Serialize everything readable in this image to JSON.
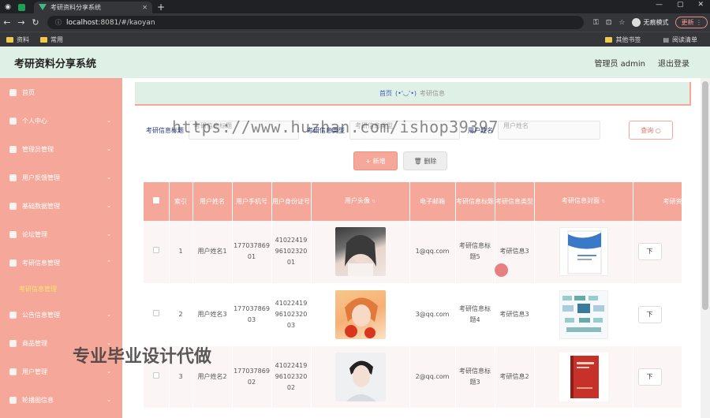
{
  "browser": {
    "tab_inactive_label": "",
    "tab_active_label": "考研资料分享系统",
    "url_host": "localhost",
    "url_rest": ":8081/#/kaoyan",
    "profile_label": "无痕模式",
    "update_label": "更新",
    "bookmarks": [
      "资料",
      "常用"
    ],
    "bookmarks_right": [
      "其他书签",
      "阅读清单"
    ]
  },
  "app": {
    "title": "考研资料分享系统",
    "user_label": "管理员 admin",
    "logout_label": "退出登录"
  },
  "sidebar": {
    "items": [
      {
        "label": "首页",
        "chevron": false
      },
      {
        "label": "个人中心",
        "chevron": true
      },
      {
        "label": "管理员管理",
        "chevron": true
      },
      {
        "label": "用户反馈管理",
        "chevron": true
      },
      {
        "label": "基础数据管理",
        "chevron": true
      },
      {
        "label": "论坛管理",
        "chevron": true
      },
      {
        "label": "考研信息管理",
        "chevron": true,
        "expanded": true
      }
    ],
    "sub_item": "考研信息管理",
    "items_after": [
      {
        "label": "公告信息管理",
        "chevron": true
      },
      {
        "label": "商品管理",
        "chevron": true
      },
      {
        "label": "用户管理",
        "chevron": true
      },
      {
        "label": "轮播图信息",
        "chevron": true
      }
    ]
  },
  "breadcrumb": {
    "home": "首页",
    "face": "(•'◡'•)",
    "current": "考研信息"
  },
  "search": {
    "label1": "考研信息标题",
    "placeholder1": "考研信息标题",
    "label2": "考研信息类型",
    "placeholder2": "考研信息类型",
    "label3": "用户姓名",
    "placeholder3": "用户姓名",
    "button": "查询 ○"
  },
  "actions": {
    "add": "+ 新增",
    "delete": "删除"
  },
  "table": {
    "headers": [
      "索引",
      "用户姓名",
      "用户手机号",
      "用户身份证号",
      "用户头像",
      "电子邮箱",
      "考研信息标题",
      "考研信息类型",
      "考研信息封面",
      "考研资"
    ],
    "rows": [
      {
        "index": "1",
        "name": "用户姓名1",
        "phone": "17703786901",
        "idcard": "410224199610232001",
        "email": "1@qq.com",
        "title": "考研信息标题5",
        "type": "考研信息3",
        "op": "下"
      },
      {
        "index": "2",
        "name": "用户姓名3",
        "phone": "17703786903",
        "idcard": "410224199610232003",
        "email": "3@qq.com",
        "title": "考研信息标题4",
        "type": "考研信息3",
        "op": "下"
      },
      {
        "index": "3",
        "name": "用户姓名2",
        "phone": "17703786902",
        "idcard": "410224199610232002",
        "email": "2@qq.com",
        "title": "考研信息标题3",
        "type": "考研信息2",
        "op": "下"
      }
    ]
  },
  "watermarks": {
    "url": "https://www.huzhan.com/ishop39397",
    "cn": "专业毕业设计代做"
  },
  "colors": {
    "accent": "#f5a89a",
    "header_bg": "#dff0e6",
    "submenu_text": "#f7e36b"
  }
}
